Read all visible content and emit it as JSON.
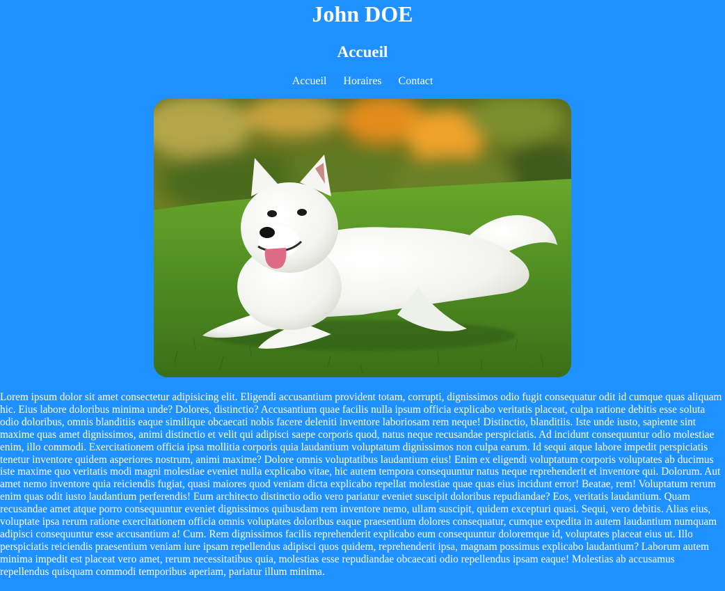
{
  "header": {
    "title": "John DOE",
    "page_heading": "Accueil"
  },
  "nav": {
    "items": [
      {
        "label": "Accueil"
      },
      {
        "label": "Horaires"
      },
      {
        "label": "Contact"
      }
    ]
  },
  "hero_image": {
    "subject": "white fluffy puppy lying on grass"
  },
  "content": {
    "paragraph": "Lorem ipsum dolor sit amet consectetur adipisicing elit. Eligendi accusantium provident totam, corrupti, dignissimos odio fugit consequatur odit id cumque quas aliquam hic. Eius labore doloribus minima unde? Dolores, distinctio? Accusantium quae facilis nulla ipsum officia explicabo veritatis placeat, culpa ratione debitis esse soluta odio doloribus, omnis blanditiis eaque similique obcaecati nobis facere deleniti inventore laboriosam rem neque! Distinctio, blanditiis. Iste unde iusto, sapiente sint maxime quas amet dignissimos, animi distinctio et velit qui adipisci saepe corporis quod, natus neque recusandae perspiciatis. Ad incidunt consequuntur odio molestiae enim, illo commodi. Exercitationem officia ipsa mollitia corporis quia laudantium voluptatum dignissimos non culpa earum. Id sequi atque labore impedit perspiciatis tenetur inventore quidem asperiores nostrum, animi maxime? Dolore omnis voluptatibus laudantium eius! Enim ex eligendi voluptatum corporis voluptates ab ducimus iste maxime quo veritatis modi magni molestiae eveniet nulla explicabo vitae, hic autem tempora consequuntur natus neque reprehenderit et inventore qui. Dolorum. Aut amet nemo inventore quia reiciendis fugiat, quasi maiores quod veniam dicta explicabo repellat molestiae quae quas eius incidunt error! Beatae, rem! Voluptatum rerum enim quas odit iusto laudantium perferendis! Eum architecto distinctio odio vero pariatur eveniet suscipit doloribus repudiandae? Eos, veritatis laudantium. Quam recusandae amet atque porro consequuntur eveniet dignissimos quibusdam rem inventore nemo, ullam suscipit, quidem excepturi quasi. Sequi, vero debitis. Alias eius, voluptate ipsa rerum ratione exercitationem officia omnis voluptates doloribus eaque praesentium dolores consequatur, cumque expedita in autem laudantium numquam adipisci consequuntur esse accusantium a! Cum. Rem dignissimos facilis reprehenderit explicabo eum consequuntur doloremque id, voluptates placeat eius ut. Illo perspiciatis reiciendis praesentium veniam iure ipsam repellendus adipisci quos quidem, reprehenderit ipsa, magnam possimus explicabo laudantium? Laborum autem minima impedit est placeat vero amet, rerum necessitatibus quia, molestias esse repudiandae obcaecati odio repellendus ipsam eaque! Molestias ab accusamus repellendus quisquam commodi temporibus aperiam, pariatur illum minima."
  },
  "colors": {
    "background": "#1e90ff",
    "text": "#ffffff"
  }
}
